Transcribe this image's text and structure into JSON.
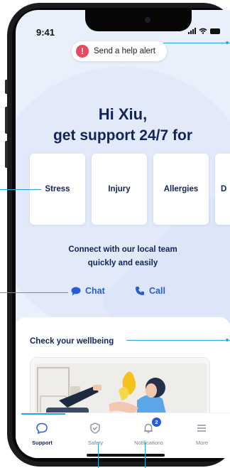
{
  "status_bar": {
    "time": "9:41"
  },
  "help_alert": {
    "label": "Send a help alert",
    "icon": "!"
  },
  "greeting": {
    "line1": "Hi Xiu,",
    "line2": "get support 24/7 for"
  },
  "topics": [
    "Stress",
    "Injury",
    "Allergies",
    "D"
  ],
  "connect": {
    "line1": "Connect with our local team",
    "line2": "quickly and easily"
  },
  "actions": {
    "chat": "Chat",
    "call": "Call"
  },
  "wellbeing": {
    "title": "Check your wellbeing"
  },
  "tabs": [
    {
      "label": "Support",
      "icon": "chat-bubble-icon",
      "active": true
    },
    {
      "label": "Safety",
      "icon": "shield-check-icon",
      "active": false
    },
    {
      "label": "Notifications",
      "icon": "bell-icon",
      "active": false,
      "badge": "2"
    },
    {
      "label": "More",
      "icon": "menu-icon",
      "active": false
    }
  ],
  "colors": {
    "brand_navy": "#13235b",
    "accent_blue": "#2a5bd7",
    "alert_red": "#e84a5f",
    "callout_line": "#2aa7d8",
    "screen_bg": "#eaf0fb"
  }
}
